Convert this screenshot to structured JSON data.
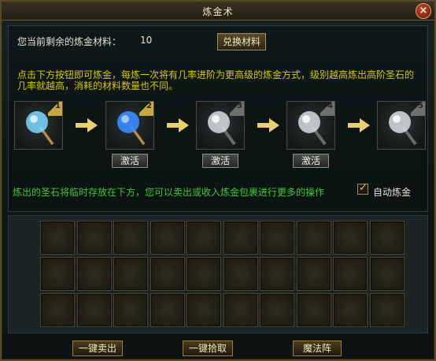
{
  "window": {
    "title": "炼金术",
    "close_label": "×"
  },
  "materials": {
    "label": "您当前剩余的炼金材料：",
    "value": "10",
    "exchange_label": "兑换材料"
  },
  "hint": "点击下方按钮即可炼金，每炼一次将有几率进阶为更高级的炼金方式，级别越高炼出高阶圣石的几率就越高，消耗的材料数量也不同。",
  "stages": [
    {
      "level": "1",
      "state": "active",
      "orb_color": "#7ad8ff"
    },
    {
      "level": "2",
      "state": "active",
      "orb_color": "#3a8cff",
      "button": "激活"
    },
    {
      "level": "3",
      "state": "locked",
      "orb_color": "#d8dde0",
      "button": "激活"
    },
    {
      "level": "4",
      "state": "locked",
      "orb_color": "#d8dde0",
      "button": "激活"
    },
    {
      "level": "5",
      "state": "locked",
      "orb_color": "#d8dde0"
    }
  ],
  "storage_note": "炼出的圣石将临时存放在下方，您可以卖出或收入炼金包裹进行更多的操作",
  "auto_alchemy": {
    "label": "自动炼金",
    "checked": true
  },
  "grid": {
    "rows": 3,
    "cols": 10
  },
  "buttons": {
    "sell_all": "一键卖出",
    "pick_all": "一键拾取",
    "magic_array": "魔法阵"
  },
  "colors": {
    "hint": "#d8c800",
    "note": "#3ec82e",
    "gold": "#c8a840"
  }
}
